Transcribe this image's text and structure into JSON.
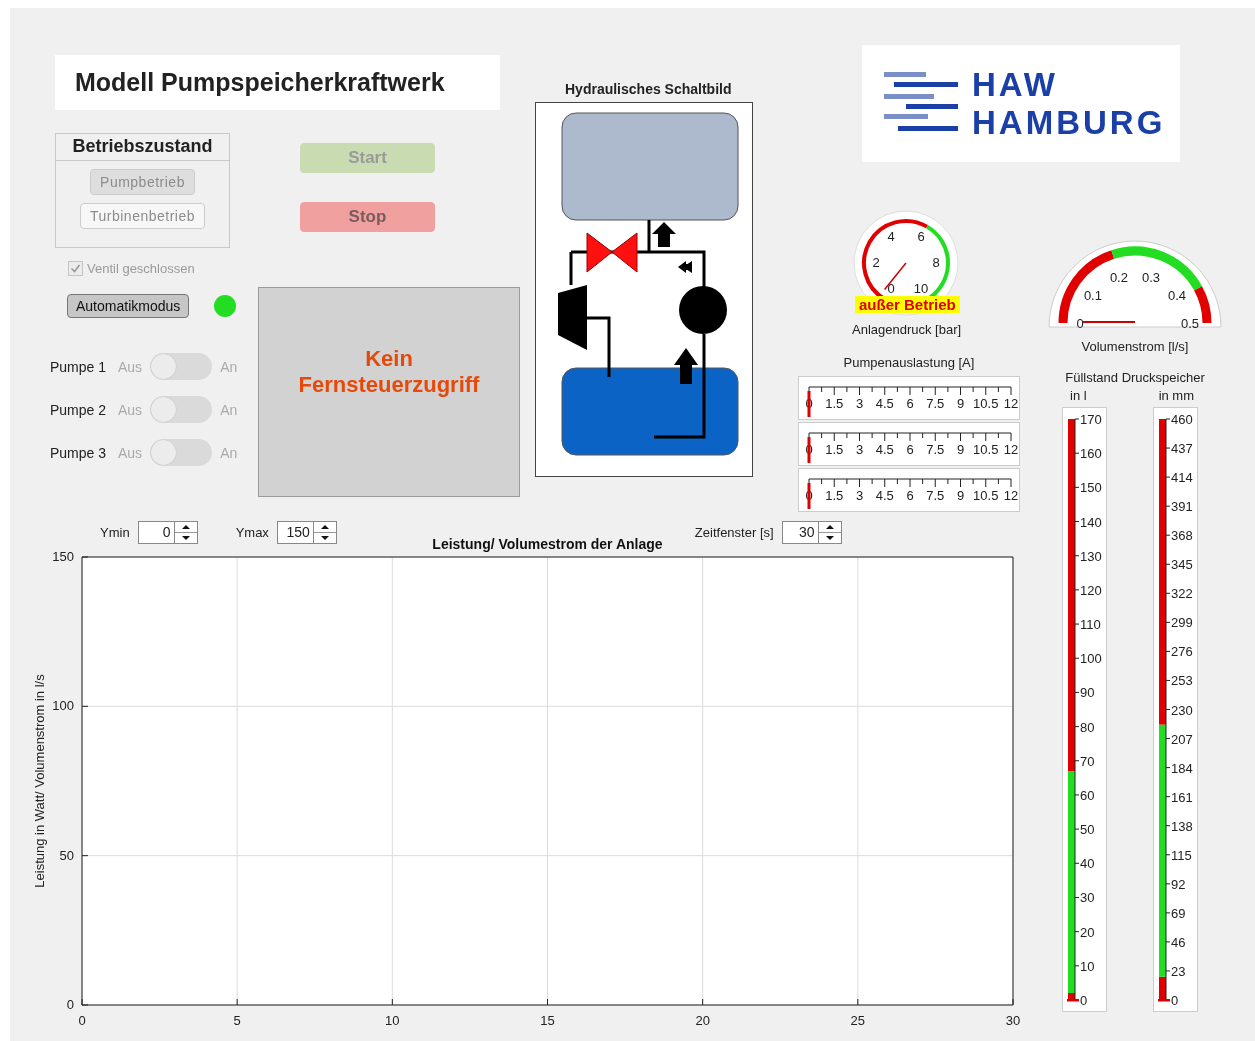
{
  "title": "Modell Pumpspeicherkraftwerk",
  "operating_mode": {
    "title": "Betriebszustand",
    "buttons": [
      {
        "label": "Pumpbetrieb",
        "selected": true,
        "disabled": true
      },
      {
        "label": "Turbinenbetrieb",
        "selected": false,
        "disabled": true
      }
    ]
  },
  "valve_checkbox": {
    "label": "Ventil geschlossen",
    "checked": true,
    "disabled": true
  },
  "auto_button": {
    "label": "Automatikmodus",
    "selected": true
  },
  "status_led": {
    "color": "#22dd22"
  },
  "pumps": [
    {
      "label": "Pumpe 1",
      "off_label": "Aus",
      "on_label": "An",
      "on": false
    },
    {
      "label": "Pumpe 2",
      "off_label": "Aus",
      "on_label": "An",
      "on": false
    },
    {
      "label": "Pumpe 3",
      "off_label": "Aus",
      "on_label": "An",
      "on": false
    }
  ],
  "start_button": {
    "label": "Start",
    "disabled": true
  },
  "stop_button": {
    "label": "Stop",
    "disabled": true
  },
  "remote_panel": {
    "text": "Kein Fernsteuerzugriff"
  },
  "schematic": {
    "title": "Hydraulisches Schaltbild"
  },
  "logo": {
    "lines": [
      "HAW",
      "HAMBURG"
    ]
  },
  "pressure_gauge": {
    "ticks": [
      "0",
      "2",
      "4",
      "6",
      "8",
      "10"
    ],
    "label": "Anlagendruck [bar]",
    "status": "außer Betrieb"
  },
  "pump_load": {
    "label": "Pumpenauslastung [A]",
    "meters": [
      {
        "level": 0,
        "ticks": [
          "0",
          "1.5",
          "3",
          "4.5",
          "6",
          "7.5",
          "9",
          "10.5",
          "12"
        ]
      },
      {
        "level": 0,
        "ticks": [
          "0",
          "1.5",
          "3",
          "4.5",
          "6",
          "7.5",
          "9",
          "10.5",
          "12"
        ]
      },
      {
        "level": 0,
        "ticks": [
          "0",
          "1.5",
          "3",
          "4.5",
          "6",
          "7.5",
          "9",
          "10.5",
          "12"
        ]
      }
    ]
  },
  "flow_gauge": {
    "ticks": [
      "0",
      "0.1",
      "0.2",
      "0.3",
      "0.4",
      "0.5"
    ],
    "label": "Volumenstrom [l/s]"
  },
  "fill_level": {
    "title": "Füllstand Druckspeicher",
    "tanks": [
      {
        "unit": "in l",
        "level": 0,
        "ticks": [
          "170",
          "160",
          "150",
          "140",
          "130",
          "120",
          "110",
          "100",
          "90",
          "80",
          "70",
          "60",
          "50",
          "40",
          "30",
          "20",
          "10",
          "0"
        ]
      },
      {
        "unit": "in mm",
        "level": 0,
        "ticks": [
          "460",
          "437",
          "414",
          "391",
          "368",
          "345",
          "322",
          "299",
          "276",
          "253",
          "230",
          "207",
          "184",
          "161",
          "138",
          "115",
          "92",
          "69",
          "46",
          "23",
          "0"
        ]
      }
    ]
  },
  "chart_controls": [
    {
      "label": "Ymin",
      "value": "0"
    },
    {
      "label": "Ymax",
      "value": "150"
    },
    {
      "label": "Zeitfenster [s]",
      "value": "30"
    }
  ],
  "plot": {
    "chart_data": {
      "type": "line",
      "grid": true,
      "title": "Leistung/ Volumestrom der Anlage",
      "ylabel": "Leistung in Watt/ Volumenstrom in l/s",
      "xlim": [
        0,
        30
      ],
      "ylim": [
        0,
        150
      ],
      "xticks": [
        0,
        5,
        10,
        15,
        20,
        25,
        30
      ],
      "yticks": [
        0,
        50,
        100,
        150
      ]
    }
  }
}
